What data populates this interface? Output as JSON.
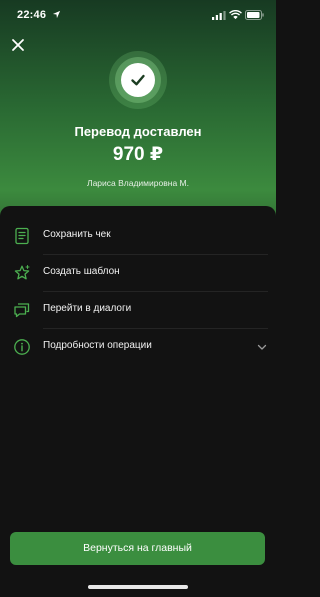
{
  "status_bar": {
    "time": "22:46"
  },
  "header": {
    "title": "Перевод доставлен",
    "amount": "970 ₽",
    "recipient": "Лариса Владимировна М."
  },
  "actions": [
    {
      "label": "Сохранить чек",
      "icon": "receipt-icon"
    },
    {
      "label": "Создать шаблон",
      "icon": "star-icon"
    },
    {
      "label": "Перейти в диалоги",
      "icon": "chat-icon"
    },
    {
      "label": "Подробности операции",
      "icon": "info-icon"
    }
  ],
  "footer": {
    "primary_button": "Вернуться на главный"
  },
  "colors": {
    "accent": "#3b8e3f",
    "icon_green": "#4caf50",
    "background": "#121212"
  }
}
